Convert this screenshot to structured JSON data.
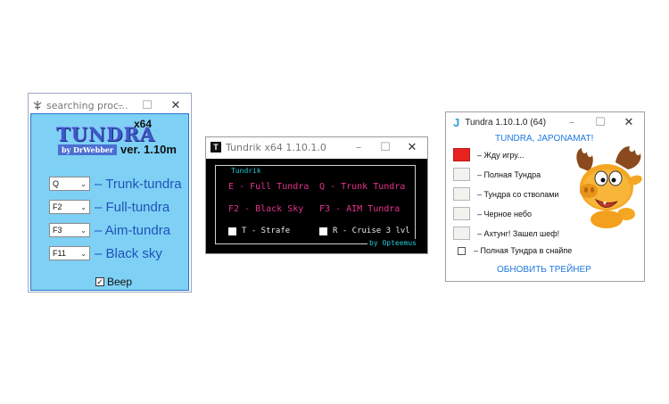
{
  "win1": {
    "title": "searching proc...",
    "logo": "TUNDRA",
    "byline": "by DrWebber",
    "arch": "x64",
    "version": "ver. 1.10m",
    "hotkeys": [
      {
        "key": "Q",
        "label": "– Trunk-tundra"
      },
      {
        "key": "F2",
        "label": "– Full-tundra"
      },
      {
        "key": "F3",
        "label": "– Aim-tundra"
      },
      {
        "key": "F11",
        "label": "– Black sky"
      }
    ],
    "beep": {
      "label": "Beep",
      "checked": true
    }
  },
  "win2": {
    "title": "Tundrik x64 1.10.1.0",
    "icon_letter": "T",
    "group": "Tundrik",
    "left": [
      "E - Full Tundra",
      "F2 - Black Sky"
    ],
    "right": [
      "Q - Trunk Tundra",
      "F3 - AIM Tundra"
    ],
    "opt_strafe": "T - Strafe",
    "opt_cruise": "R - Cruise 3 lvl",
    "signature": "by Opteemus",
    "text_color": "#e2338f",
    "accent": "#20c9d6"
  },
  "win3": {
    "title": "Tundra 1.10.1.0 (64)",
    "icon_letter": "J",
    "header": "TUNDRA, JAPONAMAT!",
    "rows": [
      "– Жду игру...",
      "– Полная Тундра",
      "– Тундра со стволами",
      "– Черное небо",
      "– Ахтунг! Зашел шеф!"
    ],
    "snipe_label": "– Полная Тундра в снайпе",
    "update_label": "ОБНОВИТЬ ТРЕЙНЕР",
    "status_color": "#e8231f"
  },
  "controls": {
    "minimize": "–",
    "maximize": "☐",
    "close": "✕"
  }
}
